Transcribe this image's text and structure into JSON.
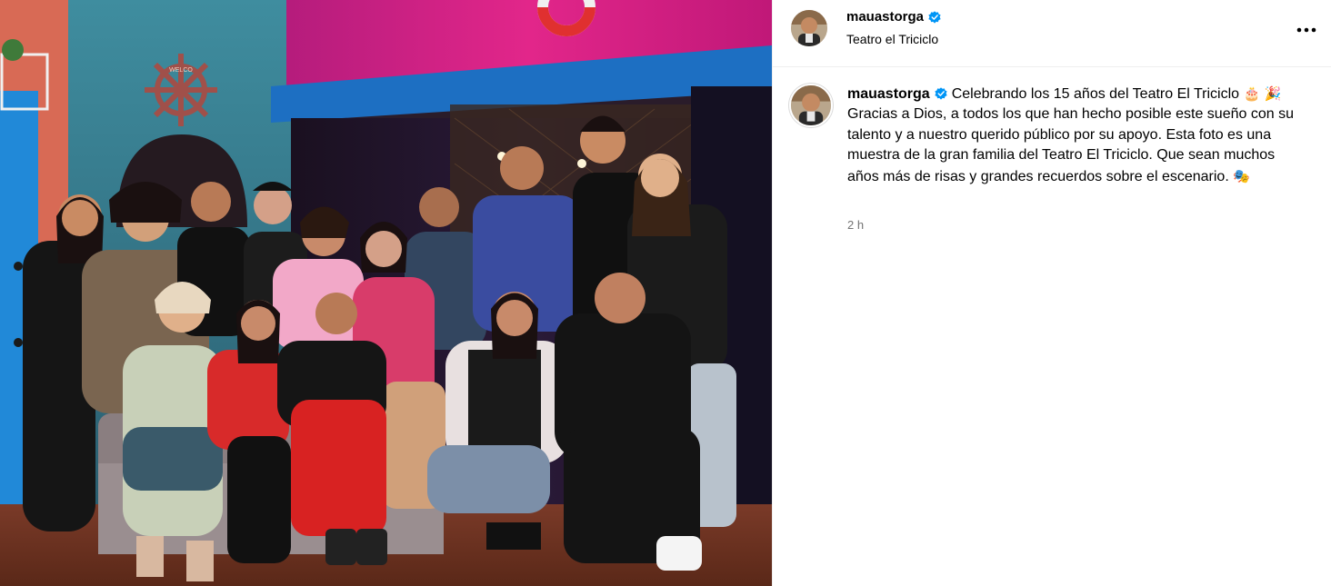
{
  "header": {
    "username": "mauastorga",
    "location": "Teatro el Triciclo",
    "verified_icon": "verified-badge-icon",
    "more_icon": "more-options-icon"
  },
  "caption": {
    "username": "mauastorga",
    "text_part1": "Celebrando los 15 años del Teatro El Triciclo ",
    "emoji_cake": "🎂",
    "emoji_party": "🎉",
    "text_part2": " Gracias a Dios, a todos los que han hecho posible este sueño con su talento y a nuestro querido público por su apoyo. Esta foto es una muestra de la gran familia del Teatro El Triciclo. Que sean muchos años más de risas y grandes recuerdos sobre el escenario. ",
    "emoji_masks": "🎭",
    "timestamp": "2 h"
  },
  "photo": {
    "ship_wheel_text": "WELCO"
  },
  "colors": {
    "verified": "#0095f6",
    "stage_pink": "#d8217a",
    "stage_blue": "#1d6fc2",
    "door_blue": "#2189d8"
  }
}
